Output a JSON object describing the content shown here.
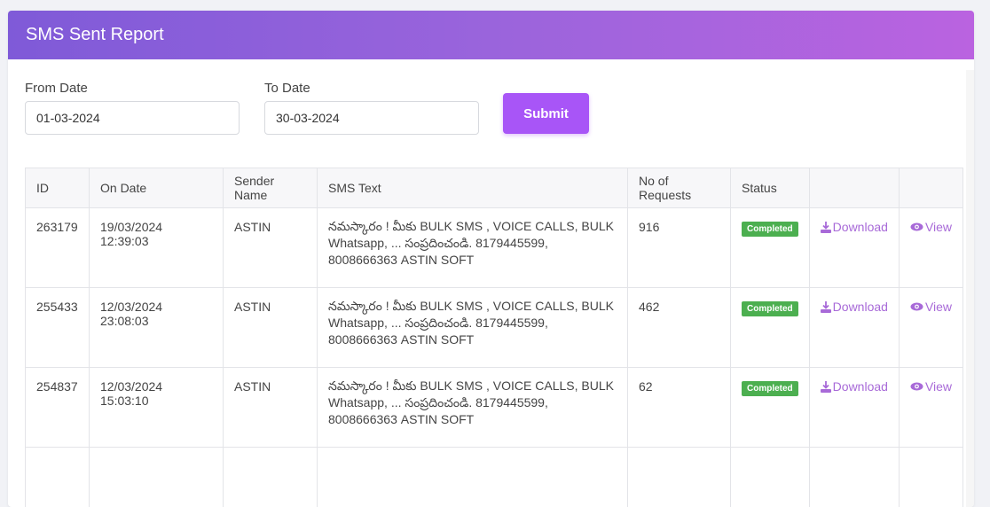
{
  "header": {
    "title": "SMS Sent Report"
  },
  "filters": {
    "from_label": "From Date",
    "from_value": "01-03-2024",
    "to_label": "To Date",
    "to_value": "30-03-2024",
    "submit_label": "Submit"
  },
  "table": {
    "columns": [
      "ID",
      "On Date",
      "Sender Name",
      "SMS Text",
      "No of Requests",
      "Status",
      "",
      ""
    ],
    "rows": [
      {
        "id": "263179",
        "on_date": "19/03/2024 12:39:03",
        "sender": "ASTIN",
        "sms": "నమస్కారం ! మీకు BULK SMS , VOICE CALLS, BULK Whatsapp, ... సంప్రదించండి. 8179445599, 8008666363 ASTIN SOFT",
        "requests": "916",
        "status": "Completed",
        "download": "Download",
        "view": "View"
      },
      {
        "id": "255433",
        "on_date": "12/03/2024 23:08:03",
        "sender": "ASTIN",
        "sms": "నమస్కారం ! మీకు BULK SMS , VOICE CALLS, BULK Whatsapp, ... సంప్రదించండి. 8179445599, 8008666363 ASTIN SOFT",
        "requests": "462",
        "status": "Completed",
        "download": "Download",
        "view": "View"
      },
      {
        "id": "254837",
        "on_date": "12/03/2024 15:03:10",
        "sender": "ASTIN",
        "sms": "నమస్కారం ! మీకు BULK SMS , VOICE CALLS, BULK Whatsapp, ... సంప్రదించండి. 8179445599, 8008666363 ASTIN SOFT",
        "requests": "62",
        "status": "Completed",
        "download": "Download",
        "view": "View"
      }
    ]
  },
  "colors": {
    "accent": "#a855f7",
    "status_completed": "#4caf50",
    "link": "#a86ad8"
  },
  "icons": {
    "download": "download-icon",
    "view": "eye-icon"
  }
}
